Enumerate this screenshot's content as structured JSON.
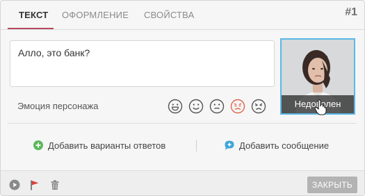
{
  "tabs": [
    {
      "label": "ТЕКСТ",
      "active": true
    },
    {
      "label": "ОФОРМЛЕНИЕ",
      "active": false
    },
    {
      "label": "СВОЙСТВА",
      "active": false
    }
  ],
  "step_number": "#1",
  "message_text": "Алло, это банк?",
  "emotion": {
    "label": "Эмоция персонажа",
    "options": [
      {
        "icon": "grin-icon",
        "selected": false
      },
      {
        "icon": "smile-icon",
        "selected": false
      },
      {
        "icon": "neutral-face-icon",
        "selected": false
      },
      {
        "icon": "displeased-face-icon",
        "selected": true
      },
      {
        "icon": "angry-face-icon",
        "selected": false
      }
    ]
  },
  "character": {
    "caption": "Недоволен"
  },
  "actions": {
    "add_answers": "Добавить варианты ответов",
    "add_message": "Добавить сообщение"
  },
  "footer": {
    "icons": [
      "play-icon",
      "flag-icon",
      "trash-icon"
    ],
    "close_label": "ЗАКРЫТЬ"
  },
  "colors": {
    "accent": "#b5485f",
    "avatar_border": "#5ab8e6",
    "selected_emotion": "#e0664a",
    "add_green": "#5cb85c",
    "add_blue": "#3ea6d8"
  }
}
